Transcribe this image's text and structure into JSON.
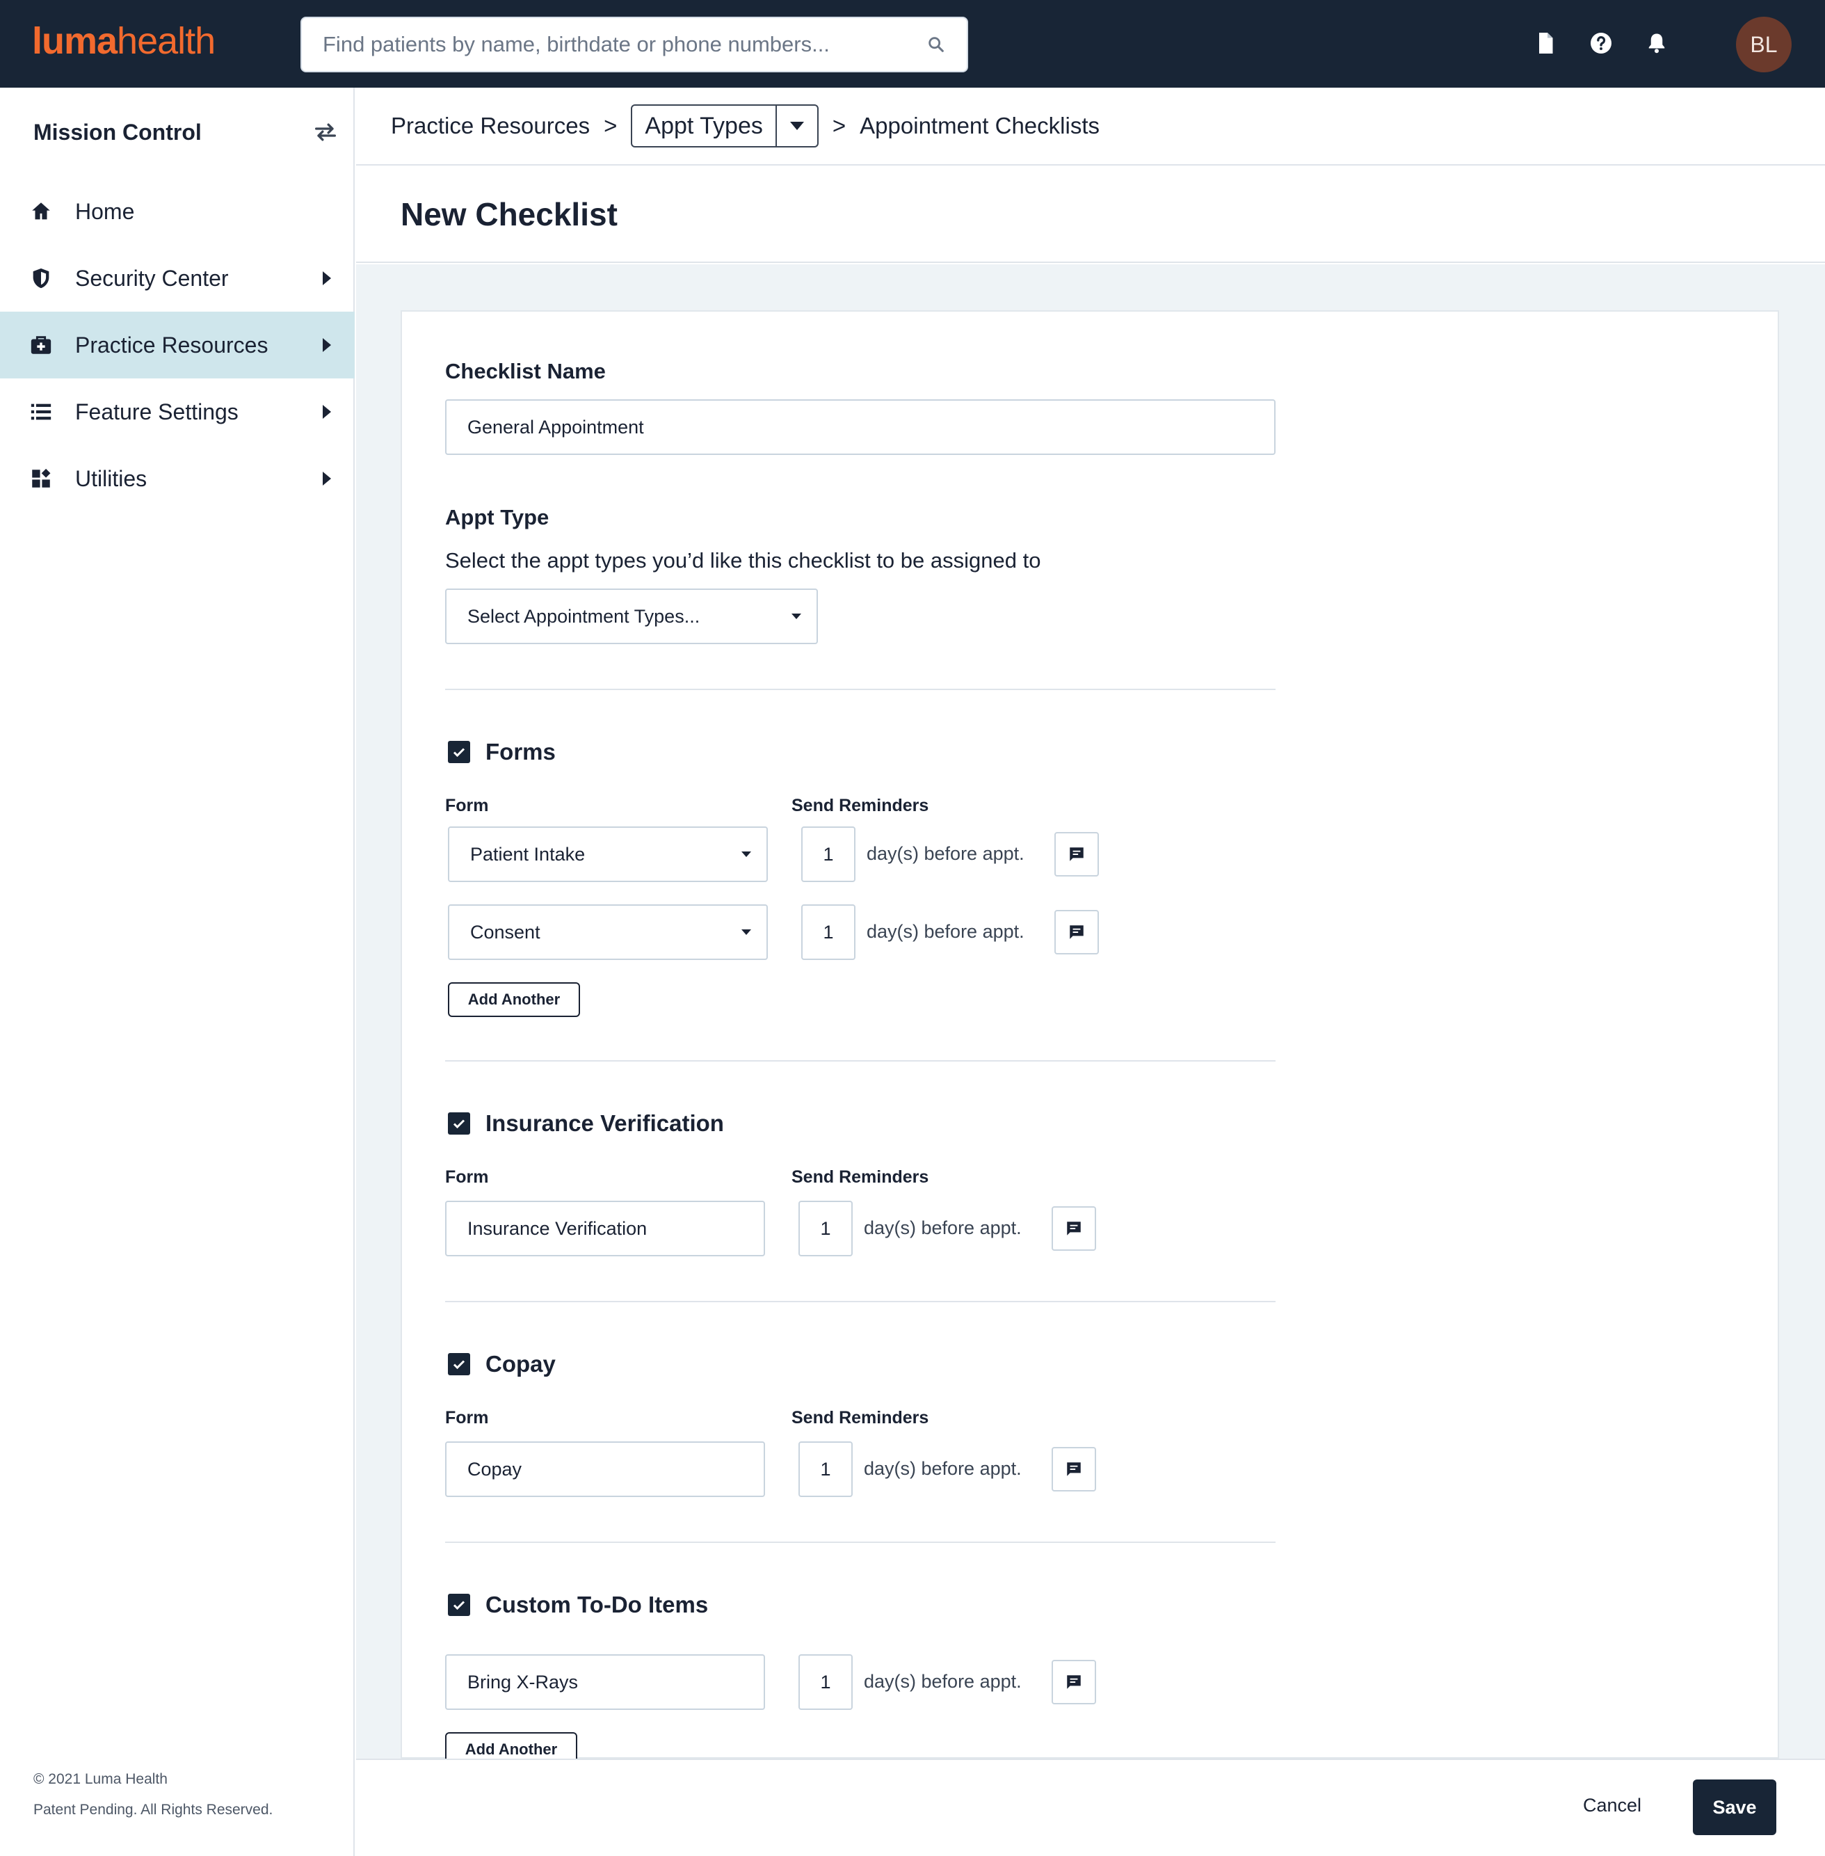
{
  "app": {
    "logo_part1": "luma",
    "logo_part2": "health",
    "search_placeholder": "Find patients by name, birthdate or phone numbers...",
    "user_initials": "BL",
    "brand_color": "#f26a2e",
    "topbar_color": "#182536"
  },
  "sidebar": {
    "title": "Mission Control",
    "items": [
      {
        "label": "Home",
        "icon": "home-icon",
        "has_caret": false,
        "active": false
      },
      {
        "label": "Security Center",
        "icon": "shield-icon",
        "has_caret": true,
        "active": false
      },
      {
        "label": "Practice Resources",
        "icon": "medical-kit-icon",
        "has_caret": true,
        "active": true
      },
      {
        "label": "Feature Settings",
        "icon": "list-icon",
        "has_caret": true,
        "active": false
      },
      {
        "label": "Utilities",
        "icon": "widgets-icon",
        "has_caret": true,
        "active": false
      }
    ],
    "footer_copyright": "© 2021 Luma Health",
    "footer_rights": "Patent Pending. All Rights Reserved."
  },
  "breadcrumb": {
    "root": "Practice Resources",
    "middle": "Appt Types",
    "current": "Appointment Checklists",
    "separator": ">"
  },
  "page": {
    "title": "New Checklist"
  },
  "form": {
    "checklist_name_label": "Checklist Name",
    "checklist_name_value": "General Appointment",
    "appt_type_label": "Appt Type",
    "appt_type_description": "Select the appt types you’d like this checklist to be assigned to",
    "appt_type_placeholder": "Select Appointment Types...",
    "form_col_label": "Form",
    "reminders_col_label": "Send Reminders",
    "days_suffix": "day(s) before appt.",
    "add_another_label": "Add Another"
  },
  "sections": {
    "forms": {
      "title": "Forms",
      "checked": true,
      "rows": [
        {
          "form": "Patient Intake",
          "days": "1"
        },
        {
          "form": "Consent",
          "days": "1"
        }
      ]
    },
    "insurance": {
      "title": "Insurance Verification",
      "checked": true,
      "form": "Insurance Verification",
      "days": "1"
    },
    "copay": {
      "title": "Copay",
      "checked": true,
      "form": "Copay",
      "days": "1"
    },
    "custom": {
      "title": "Custom To-Do Items",
      "checked": true,
      "item": "Bring X-Rays",
      "days": "1"
    }
  },
  "actions": {
    "cancel": "Cancel",
    "save": "Save"
  }
}
